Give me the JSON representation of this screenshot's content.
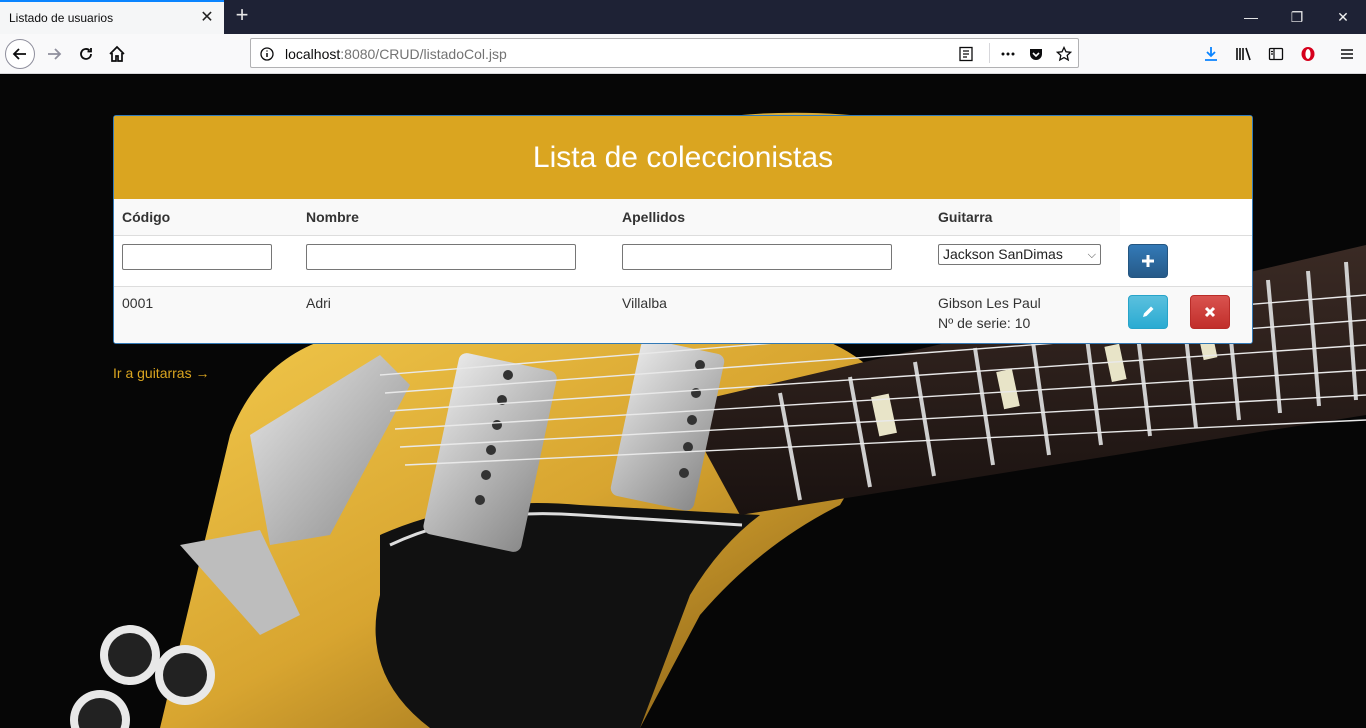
{
  "browser": {
    "tab_title": "Listado de usuarios",
    "url_host": "localhost",
    "url_rest": ":8080/CRUD/listadoCol.jsp"
  },
  "page": {
    "panel_title": "Lista de coleccionistas",
    "columns": {
      "codigo": "Código",
      "nombre": "Nombre",
      "apellidos": "Apellidos",
      "guitarra": "Guitarra"
    },
    "new_row": {
      "codigo_value": "",
      "nombre_value": "",
      "apellidos_value": "",
      "guitarra_selected": "Jackson SanDimas"
    },
    "rows": [
      {
        "codigo": "0001",
        "nombre": "Adri",
        "apellidos": "Villalba",
        "guitarra_model": "Gibson Les Paul",
        "guitarra_serial": "Nº de serie: 10"
      }
    ],
    "link_guitars": "Ir a guitarras →"
  },
  "colors": {
    "panel_heading": "#daa520",
    "link": "#daa520",
    "btn_add": "#337ab7",
    "btn_edit": "#5bc0de",
    "btn_delete": "#d9534f"
  }
}
